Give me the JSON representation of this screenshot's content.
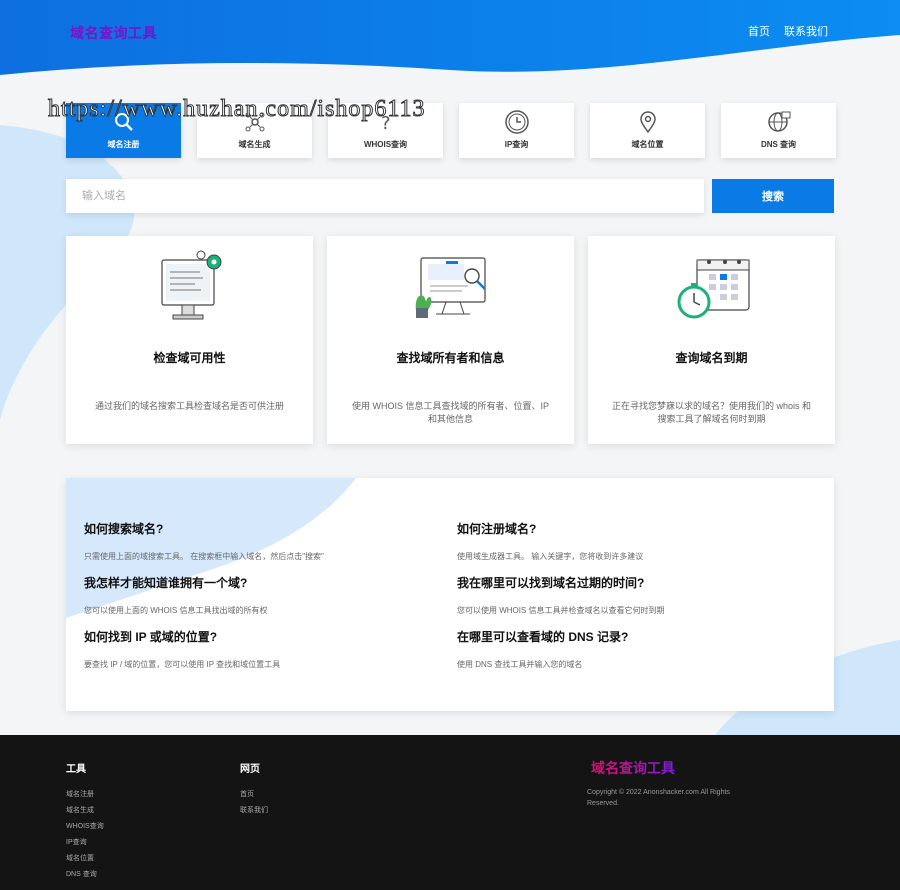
{
  "header": {
    "logo": "域名查询工具",
    "nav": [
      "首页",
      "联系我们"
    ]
  },
  "watermark": "https://www.huzhan.com/ishop6113",
  "tabs": [
    {
      "label": "域名注册",
      "icon": "search-icon",
      "active": true
    },
    {
      "label": "域名生成",
      "icon": "network-icon",
      "active": false
    },
    {
      "label": "WHOIS查询",
      "icon": "question-icon",
      "active": false
    },
    {
      "label": "IP查询",
      "icon": "clock-icon",
      "active": false
    },
    {
      "label": "域名位置",
      "icon": "location-pin-icon",
      "active": false
    },
    {
      "label": "DNS 查询",
      "icon": "globe-icon",
      "active": false
    }
  ],
  "search": {
    "placeholder": "输入域名",
    "button": "搜索"
  },
  "features": [
    {
      "title": "检查域可用性",
      "desc": "通过我们的域名搜索工具检查域名是否可供注册",
      "icon": "monitor-gear-illustration"
    },
    {
      "title": "查找域所有者和信息",
      "desc": "使用 WHOIS 信息工具查找域的所有者、位置、IP 和其他信息",
      "icon": "screen-magnifier-illustration"
    },
    {
      "title": "查询域名到期",
      "desc": "正在寻找您梦寐以求的域名？使用我们的 whois 和搜索工具了解域名何时到期",
      "icon": "calendar-stopwatch-illustration"
    }
  ],
  "faq": [
    {
      "q": "如何搜索域名?",
      "a": "只需使用上面的域搜索工具。 在搜索框中输入域名，然后点击\"搜索\""
    },
    {
      "q": "如何注册域名?",
      "a": "使用域生成器工具。 输入关键字，您将收到许多建议"
    },
    {
      "q": "我怎样才能知道谁拥有一个域?",
      "a": "您可以使用上面的 WHOIS 信息工具找出域的所有权"
    },
    {
      "q": "我在哪里可以找到域名过期的时间?",
      "a": "您可以使用 WHOIS 信息工具并检查域名以查看它何时到期"
    },
    {
      "q": "如何找到 IP 或域的位置?",
      "a": "要查找 IP / 域的位置，您可以使用 IP 查找和域位置工具"
    },
    {
      "q": "在哪里可以查看域的 DNS 记录?",
      "a": "使用 DNS 查找工具并输入您的域名"
    }
  ],
  "footer": {
    "tools_title": "工具",
    "tools": [
      "域名注册",
      "域名生成",
      "WHOIS查询",
      "IP查询",
      "域名位置",
      "DNS 查询"
    ],
    "pages_title": "网页",
    "pages": [
      "首页",
      "联系我们"
    ],
    "logo": "域名查询工具",
    "copyright": "Copyright © 2022 Anonshacker.com All Rights Reserved."
  },
  "colors": {
    "primary": "#0a7be6",
    "footer_bg": "#141414",
    "logo_start": "#e0106e",
    "logo_end": "#7b1fd6"
  }
}
